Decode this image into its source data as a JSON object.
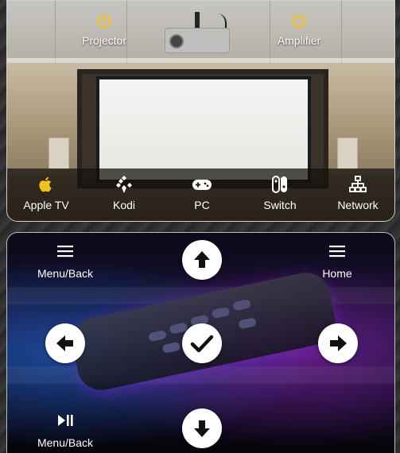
{
  "power": {
    "projector": {
      "label": "Projector",
      "icon": "power-icon",
      "color": "#f4c21b"
    },
    "amplifier": {
      "label": "Amplifier",
      "icon": "power-icon",
      "color": "#f4c21b"
    }
  },
  "sources": [
    {
      "label": "Apple TV",
      "icon": "apple-icon",
      "color": "#f4c21b"
    },
    {
      "label": "Kodi",
      "icon": "kodi-icon",
      "color": "#ffffff"
    },
    {
      "label": "PC",
      "icon": "gamepad-icon",
      "color": "#ffffff"
    },
    {
      "label": "Switch",
      "icon": "switch-icon",
      "color": "#ffffff"
    },
    {
      "label": "Network",
      "icon": "network-icon",
      "color": "#ffffff"
    }
  ],
  "remote": {
    "menu_back_label": "Menu/Back",
    "home_label": "Home",
    "play_pause_label": "Menu/Back",
    "up": "arrow-up-icon",
    "down": "arrow-down-icon",
    "left": "arrow-left-icon",
    "right": "arrow-right-icon",
    "select": "checkmark-icon"
  }
}
